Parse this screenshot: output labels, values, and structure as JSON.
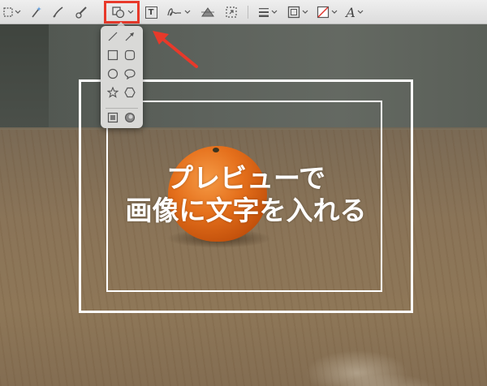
{
  "toolbar": {
    "tools": [
      {
        "name": "rectangular-selection"
      },
      {
        "name": "instant-alpha"
      },
      {
        "name": "sketch"
      },
      {
        "name": "draw"
      },
      {
        "name": "shapes"
      },
      {
        "name": "text"
      },
      {
        "name": "sign"
      },
      {
        "name": "adjust-color"
      },
      {
        "name": "adjust-size"
      },
      {
        "name": "shape-style"
      },
      {
        "name": "border-color"
      },
      {
        "name": "fill-color"
      },
      {
        "name": "text-style"
      }
    ],
    "text_tool_glyph": "T",
    "text_style_glyph": "A",
    "highlight_color": "#e8392a"
  },
  "shape_menu": {
    "items": [
      "line",
      "arrow",
      "rectangle",
      "rounded-rectangle",
      "oval",
      "speech-bubble",
      "star",
      "hexagon",
      "mask",
      "loupe"
    ]
  },
  "caption": {
    "line1": "プレビューで",
    "line2": "画像に文字を入れる"
  },
  "annotation": {
    "arrow_color": "#e8392a"
  }
}
